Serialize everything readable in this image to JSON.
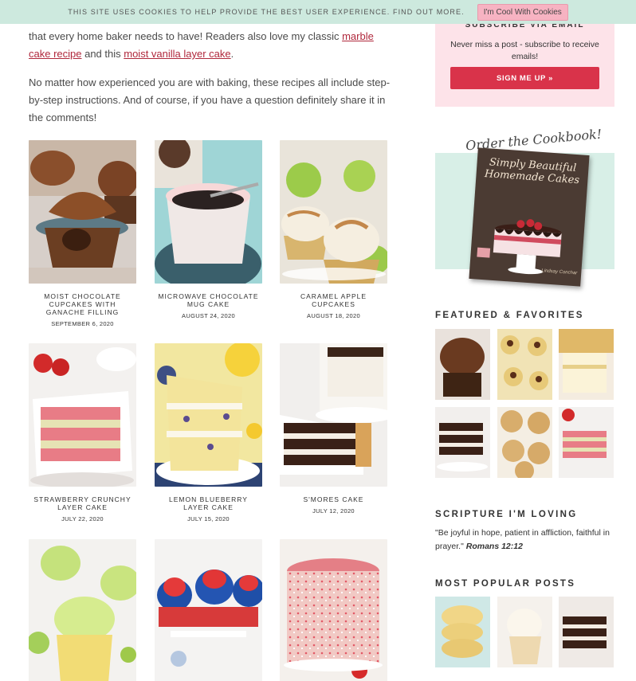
{
  "cookie_bar": {
    "text": "THIS SITE USES COOKIES TO HELP PROVIDE THE BEST USER EXPERIENCE. FIND OUT MORE.",
    "button": "I'm Cool With Cookies"
  },
  "intro": {
    "p1_start": "that every home baker needs to have! Readers also love my classic ",
    "link1": "marble cake recipe",
    "p1_mid": " and this ",
    "link2": "moist vanilla layer cake",
    "p1_end": ".",
    "p2": "No matter how experienced you are with baking, these recipes all include step-by-step instructions. And of course, if you have a question definitely share it in the comments!"
  },
  "recipes": [
    {
      "title": "MOIST CHOCOLATE CUPCAKES WITH GANACHE FILLING",
      "date": "SEPTEMBER 6, 2020"
    },
    {
      "title": "MICROWAVE CHOCOLATE MUG CAKE",
      "date": "AUGUST 24, 2020"
    },
    {
      "title": "CARAMEL APPLE CUPCAKES",
      "date": "AUGUST 18, 2020"
    },
    {
      "title": "STRAWBERRY CRUNCHY LAYER CAKE",
      "date": "JULY 22, 2020"
    },
    {
      "title": "LEMON BLUEBERRY LAYER CAKE",
      "date": "JULY 15, 2020"
    },
    {
      "title": "S'MORES CAKE",
      "date": "JULY 12, 2020"
    },
    {
      "title": "",
      "date": ""
    },
    {
      "title": "",
      "date": ""
    },
    {
      "title": "",
      "date": ""
    }
  ],
  "sidebar": {
    "subscribe_title": "SUBSCRIBE VIA EMAIL",
    "subscribe_text": "Never miss a post - subscribe to receive emails!",
    "signup_button": "SIGN ME UP »",
    "cookbook_script": "Order the Cookbook!",
    "cookbook_title": "Simply Beautiful Homemade Cakes",
    "cookbook_author": "Lindsay Conchar",
    "featured_title": "FEATURED & FAVORITES",
    "scripture_title": "SCRIPTURE I'M LOVING",
    "scripture_text": "\"Be joyful in hope, patient in affliction, faithful in prayer.\"",
    "scripture_ref": "Romans 12:12",
    "popular_title": "MOST POPULAR POSTS"
  },
  "colors": {
    "cookie_bar": "#cde9de",
    "cookie_button": "#f7b3c2",
    "subscribe_bg": "#fde3e9",
    "signup_button": "#d9334a",
    "link": "#b0283c",
    "cookbook_bg": "#d8efe7"
  }
}
